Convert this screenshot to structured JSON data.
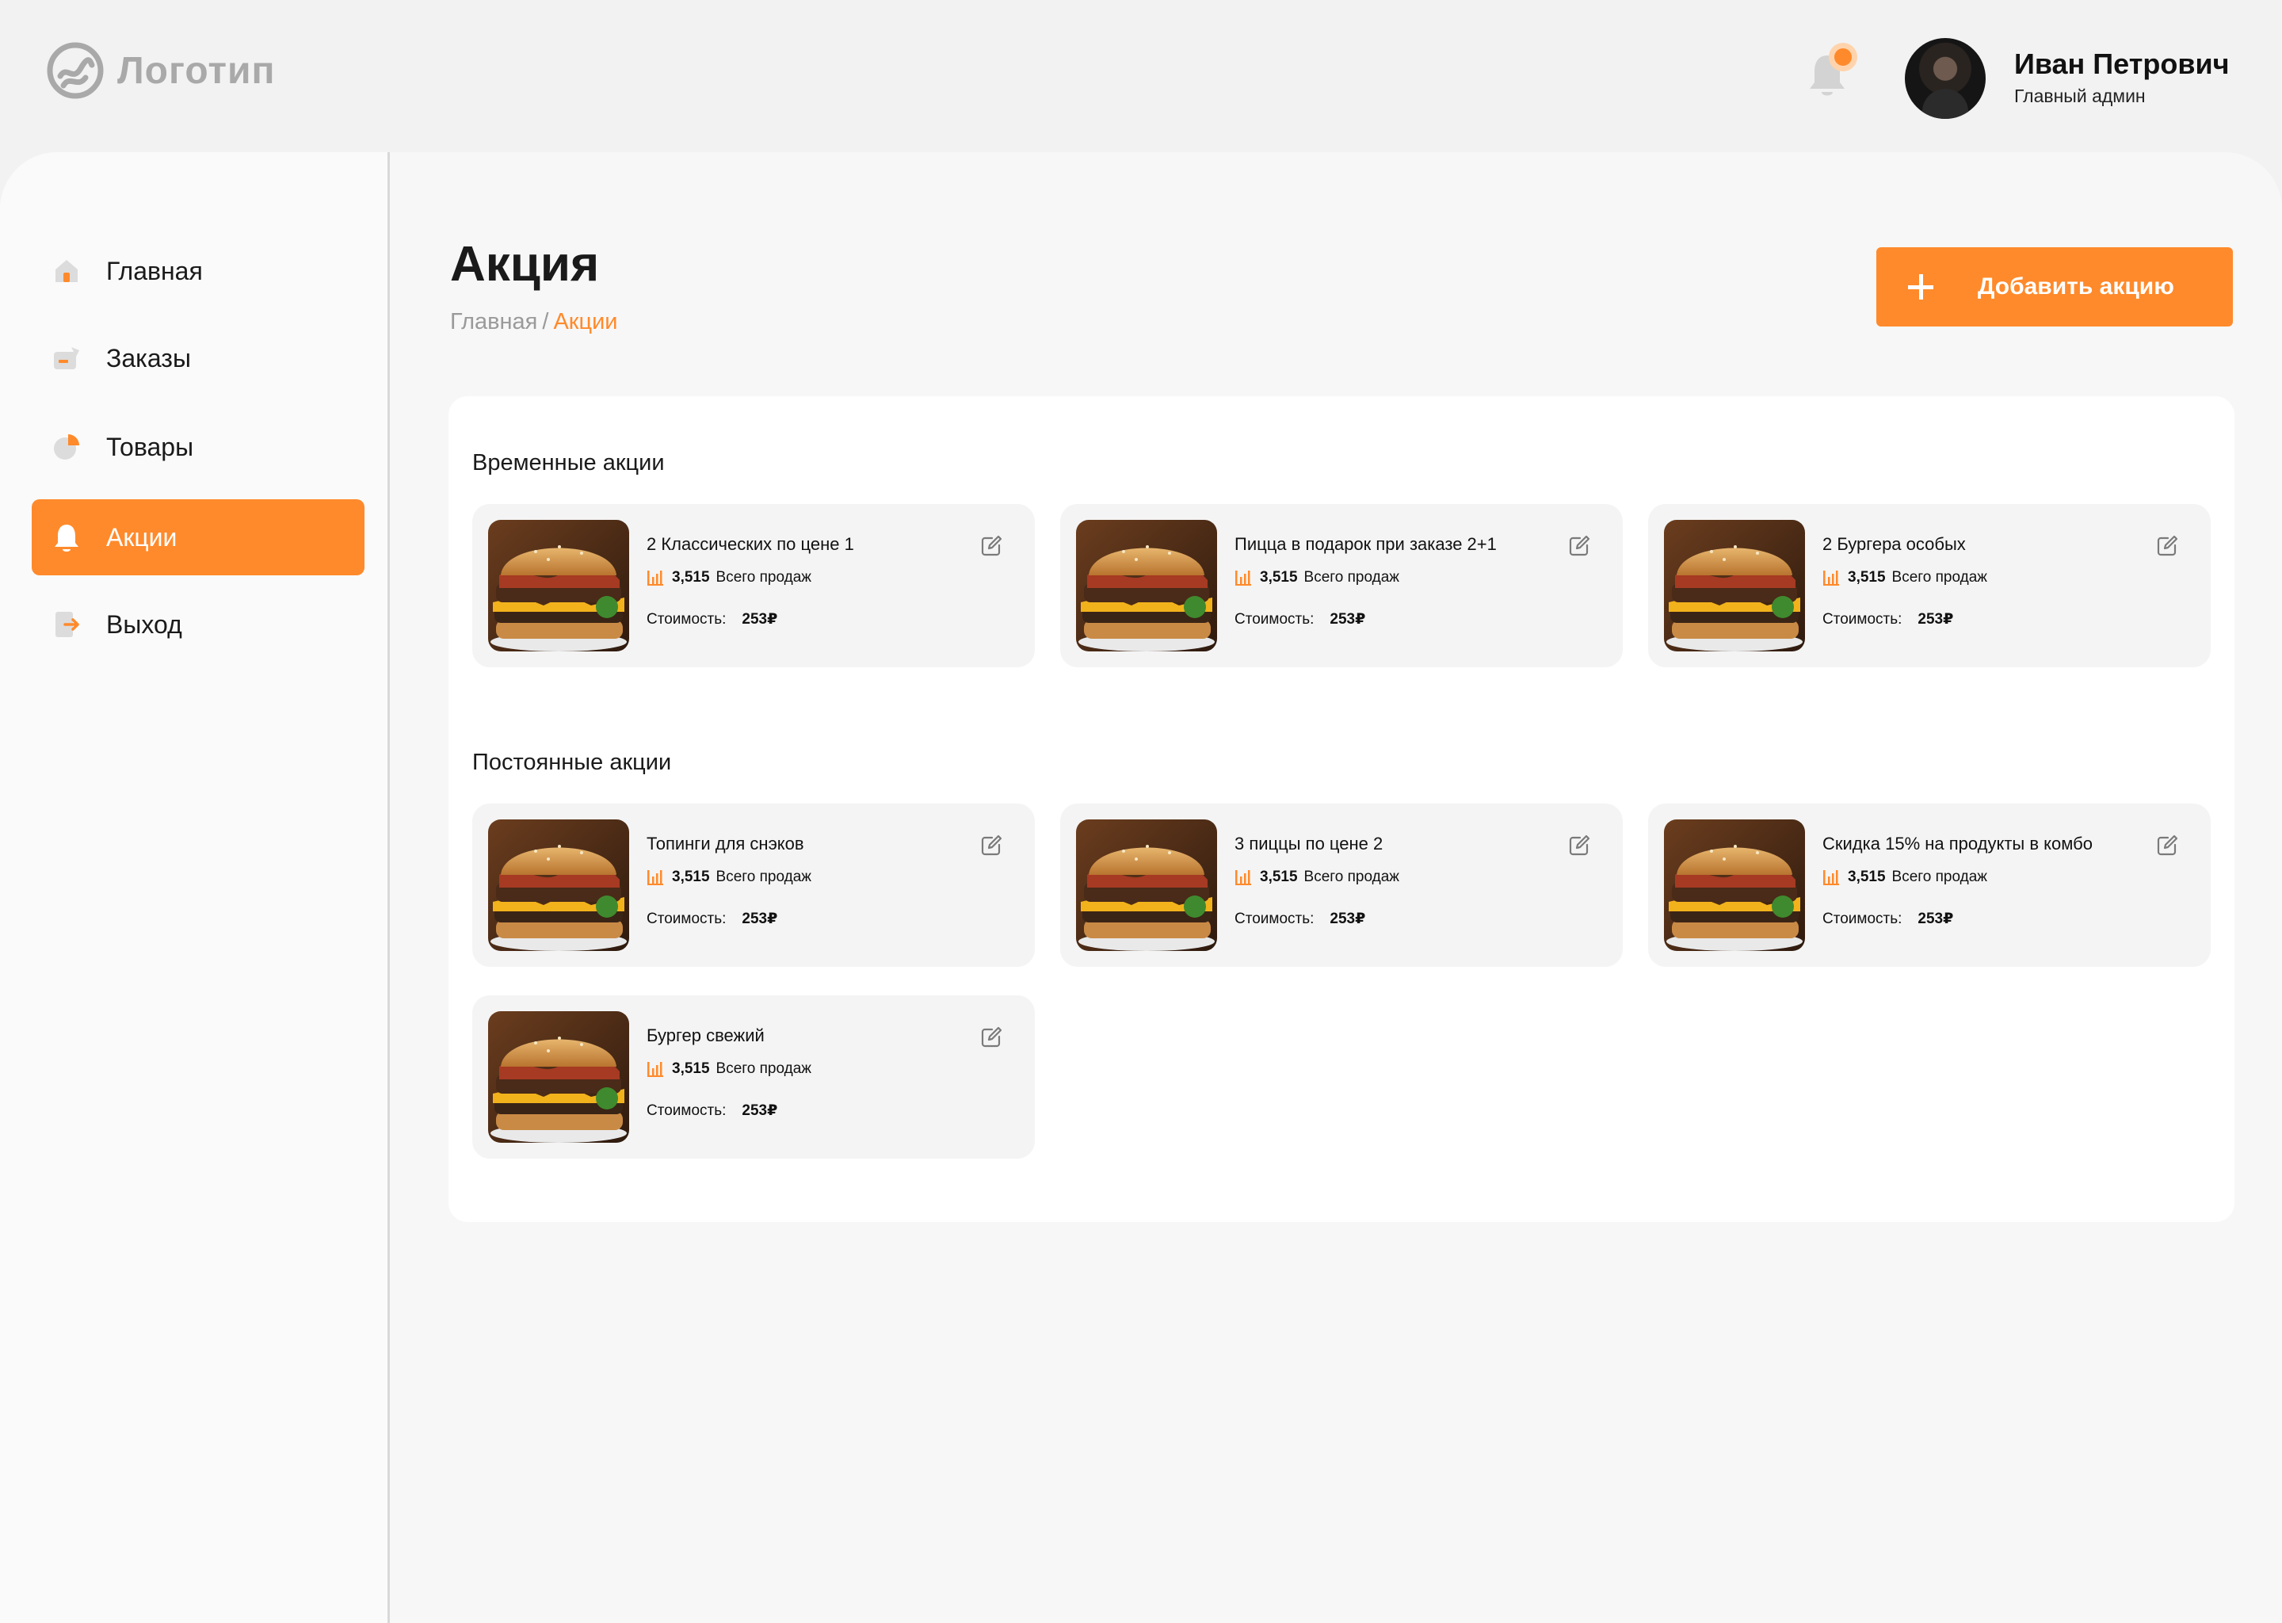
{
  "header": {
    "logo_text": "Логотип",
    "user_name": "Иван Петрович",
    "user_role": "Главный админ"
  },
  "sidebar": {
    "items": [
      {
        "label": "Главная",
        "icon": "home-icon"
      },
      {
        "label": "Заказы",
        "icon": "orders-icon"
      },
      {
        "label": "Товары",
        "icon": "products-icon"
      },
      {
        "label": "Акции",
        "icon": "bell-icon",
        "active": true
      },
      {
        "label": "Выход",
        "icon": "logout-icon"
      }
    ]
  },
  "page": {
    "title": "Акция",
    "breadcrumb_home": "Главная",
    "breadcrumb_sep": "/",
    "breadcrumb_current": "Акции",
    "add_button": "Добавить акцию"
  },
  "sections": {
    "temporary": {
      "title": "Временные акции",
      "cards": [
        {
          "title": "2 Классических по цене 1",
          "sales": "3,515",
          "sales_label": "Всего продаж",
          "price_label": "Стоимость:",
          "price": "253₽"
        },
        {
          "title": "Пицца в подарок при заказе 2+1",
          "sales": "3,515",
          "sales_label": "Всего продаж",
          "price_label": "Стоимость:",
          "price": "253₽"
        },
        {
          "title": "2 Бургера особых",
          "sales": "3,515",
          "sales_label": "Всего продаж",
          "price_label": "Стоимость:",
          "price": "253₽"
        }
      ]
    },
    "permanent": {
      "title": "Постоянные акции",
      "cards": [
        {
          "title": "Топинги для снэков",
          "sales": "3,515",
          "sales_label": "Всего продаж",
          "price_label": "Стоимость:",
          "price": "253₽"
        },
        {
          "title": "3 пиццы по цене 2",
          "sales": "3,515",
          "sales_label": "Всего продаж",
          "price_label": "Стоимость:",
          "price": "253₽"
        },
        {
          "title": "Скидка 15% на продукты в комбо",
          "sales": "3,515",
          "sales_label": "Всего продаж",
          "price_label": "Стоимость:",
          "price": "253₽"
        },
        {
          "title": "Бургер свежий",
          "sales": "3,515",
          "sales_label": "Всего продаж",
          "price_label": "Стоимость:",
          "price": "253₽"
        }
      ]
    }
  },
  "colors": {
    "accent": "#ff8a2b",
    "background": "#f2f2f2",
    "card": "#f4f4f4"
  }
}
